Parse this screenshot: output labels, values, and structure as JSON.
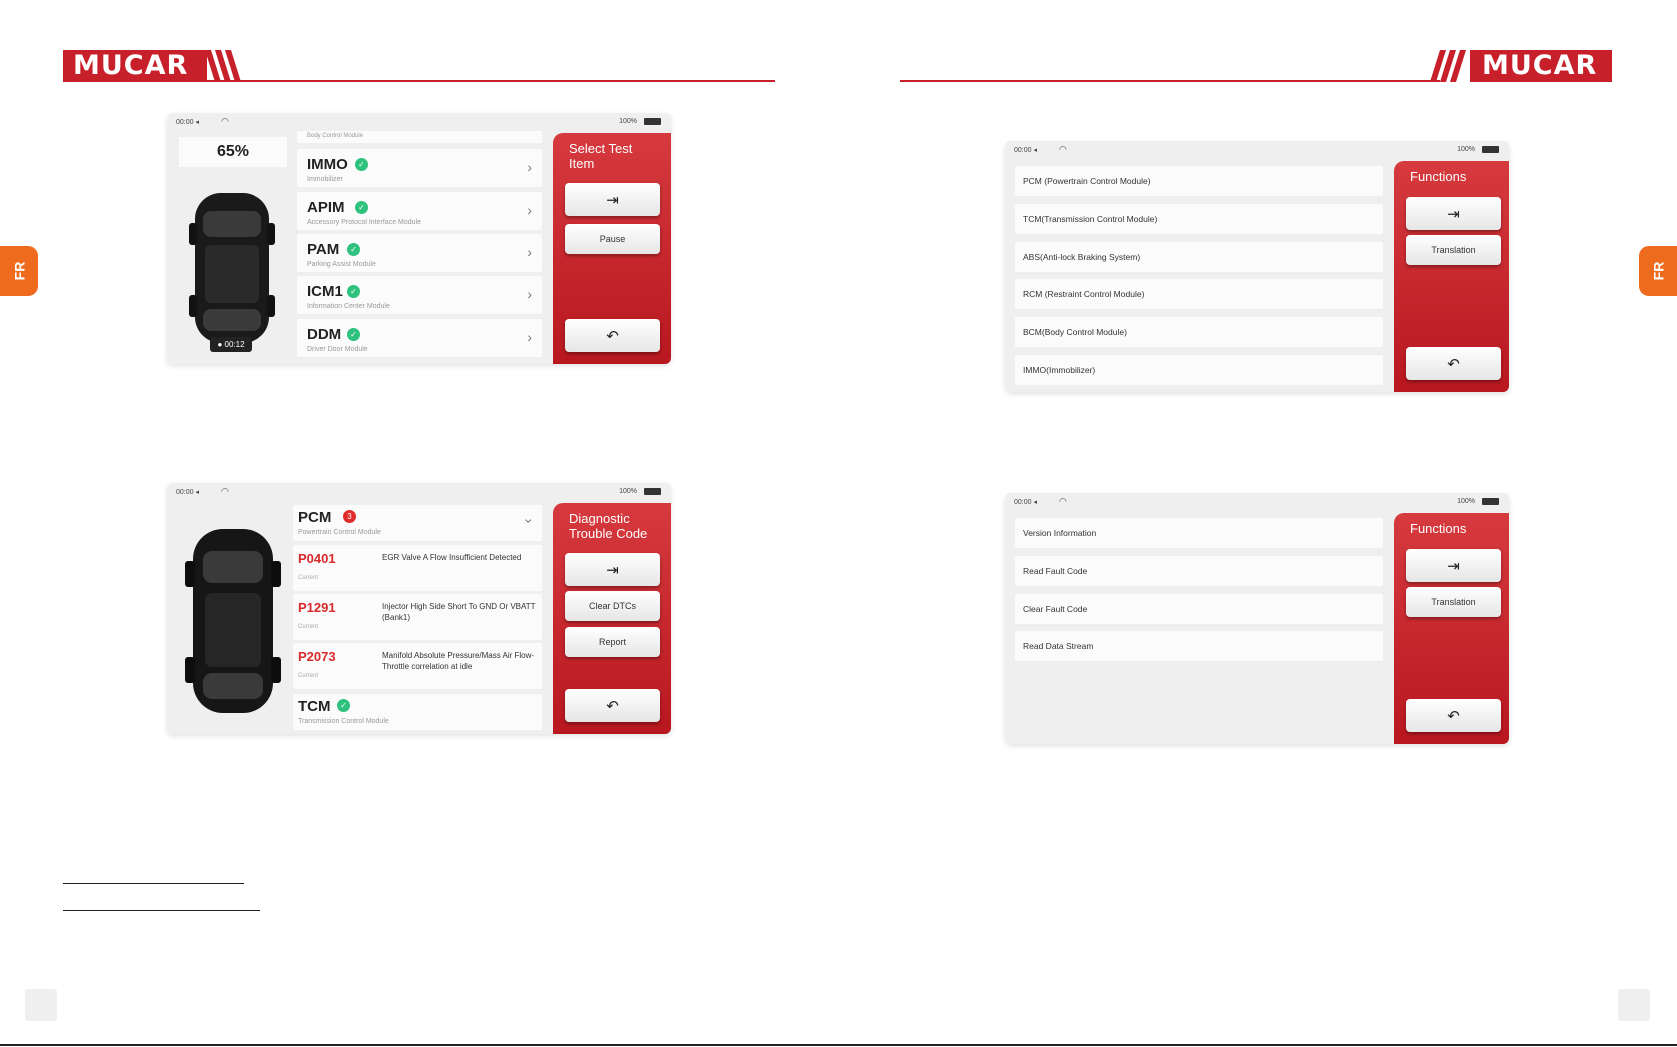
{
  "header": {
    "brand": "MUCAR"
  },
  "side_tab": {
    "label": "FR"
  },
  "screen1": {
    "status": {
      "time": "00:00 ◂",
      "battery": "100%"
    },
    "percent": "65%",
    "timer": "00:12",
    "top_label": "Body Control Module",
    "modules": [
      {
        "name": "IMMO",
        "desc": "Immobilizer"
      },
      {
        "name": "APIM",
        "desc": "Accessory Protocol Interface Module"
      },
      {
        "name": "PAM",
        "desc": "Parking Assist Module"
      },
      {
        "name": "ICM1",
        "desc": "Information Center Module"
      },
      {
        "name": "DDM",
        "desc": "Driver Door Module"
      }
    ],
    "panel": {
      "title": "Select Test Item",
      "pause": "Pause"
    }
  },
  "screen2": {
    "status": {
      "time": "00:00 ◂",
      "battery": "100%"
    },
    "items": [
      "PCM (Powertrain Control Module)",
      "TCM(Transmission Control Module)",
      "ABS(Anti-lock Braking System)",
      "RCM (Restraint Control Module)",
      "BCM(Body Control Module)",
      "IMMO(Immobilizer)"
    ],
    "panel": {
      "title": "Functions",
      "translation": "Translation"
    }
  },
  "screen3": {
    "status": {
      "time": "00:00 ◂",
      "battery": "100%"
    },
    "pcm": {
      "name": "PCM",
      "desc": "Powertrain Control Module",
      "badge": "3"
    },
    "dtcs": [
      {
        "code": "P0401",
        "sub": "Current",
        "desc": "EGR Valve A Flow Insufficient Detected"
      },
      {
        "code": "P1291",
        "sub": "Current",
        "desc": "Injector High Side Short To GND Or VBATT (Bank1)"
      },
      {
        "code": "P2073",
        "sub": "Current",
        "desc": "Manifold Absolute Pressure/Mass Air Flow-Throttle correlation at idle"
      }
    ],
    "tcm": {
      "name": "TCM",
      "desc": "Transmission Control Module"
    },
    "panel": {
      "title": "Diagnostic Trouble Code",
      "clear": "Clear DTCs",
      "report": "Report"
    }
  },
  "screen4": {
    "status": {
      "time": "00:00 ◂",
      "battery": "100%"
    },
    "items": [
      "Version Information",
      "Read Fault Code",
      "Clear Fault Code",
      "Read Data Stream"
    ],
    "panel": {
      "title": "Functions",
      "translation": "Translation"
    }
  },
  "colors": {
    "brand_red": "#c8202a",
    "tab_orange": "#ee6a1d",
    "ok_green": "#2ec27e",
    "dtc_red": "#d82a2a"
  },
  "icons": {
    "exit": "exit-icon",
    "back": "back-icon",
    "chevron": "chevron-right-icon",
    "check": "check-icon"
  }
}
